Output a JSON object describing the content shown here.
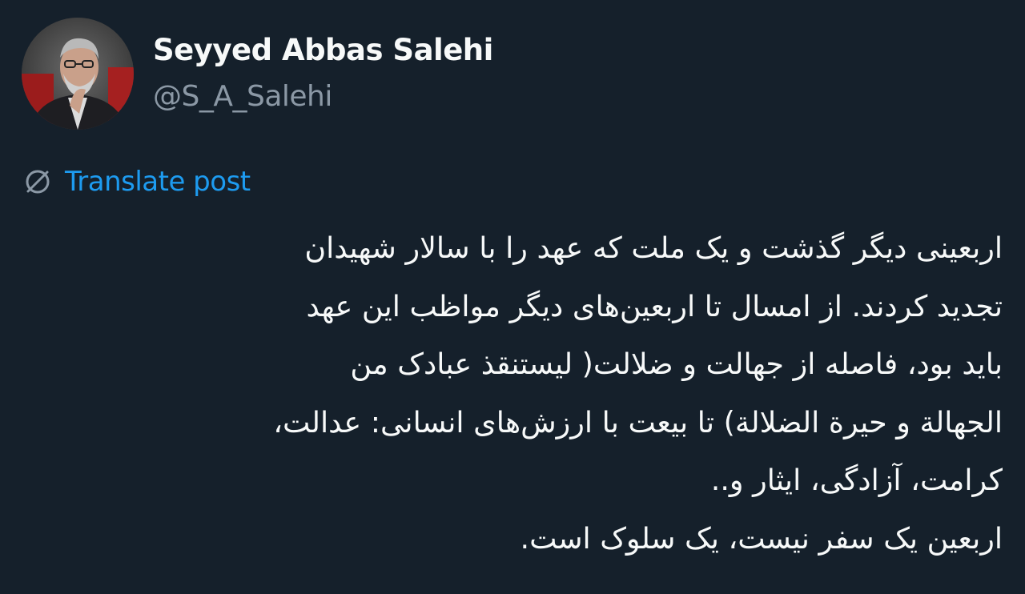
{
  "author": {
    "display_name": "Seyyed Abbas Salehi",
    "handle": "@S_A_Salehi",
    "avatar_icon": "profile-photo"
  },
  "translate": {
    "icon": "globe-translate-icon",
    "label": "Translate post"
  },
  "post": {
    "language": "fa",
    "lines": [
      "اربعینی دیگر گذشت و یک ملت که عهد را با سالار شهیدان",
      "تجدید کردند. از امسال تا اربعین‌های دیگر مواظب این عهد",
      "باید بود، فاصله از جهالت و ضلالت( لیستنقذ عبادک من",
      "الجهالة و حیرة الضلالة) تا بیعت با ارزش‌های انسانی: عدالت،",
      "کرامت، آزادگی، ایثار و..",
      "اربعین یک سفر نیست، یک سلوک است."
    ]
  },
  "colors": {
    "background": "#15202b",
    "text_primary": "#f7f9f9",
    "text_secondary": "#8b98a5",
    "link": "#1d9bf0"
  }
}
